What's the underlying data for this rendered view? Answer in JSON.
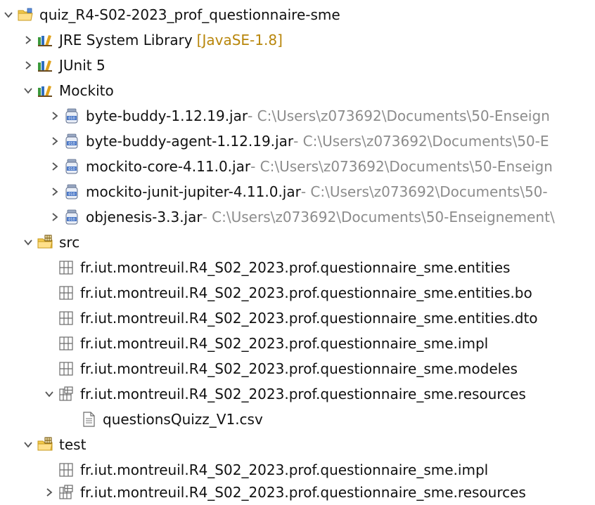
{
  "tree": {
    "project": {
      "label": "quiz_R4-S02-2023_prof_questionnaire-sme",
      "expanded": true,
      "icon": "project-folder-icon",
      "children": {
        "jre": {
          "label": "JRE System Library",
          "decoration": "[JavaSE-1.8]",
          "expanded": false,
          "icon": "library-icon"
        },
        "junit": {
          "label": "JUnit 5",
          "expanded": false,
          "icon": "library-icon"
        },
        "mockito": {
          "label": "Mockito",
          "expanded": true,
          "icon": "library-icon",
          "jars": [
            {
              "label": "byte-buddy-1.12.19.jar",
              "decoration": " - C:\\Users\\z073692\\Documents\\50-Enseign",
              "expanded": false,
              "icon": "jar-icon"
            },
            {
              "label": "byte-buddy-agent-1.12.19.jar",
              "decoration": " - C:\\Users\\z073692\\Documents\\50-E",
              "expanded": false,
              "icon": "jar-icon"
            },
            {
              "label": "mockito-core-4.11.0.jar",
              "decoration": " - C:\\Users\\z073692\\Documents\\50-Enseign",
              "expanded": false,
              "icon": "jar-icon"
            },
            {
              "label": "mockito-junit-jupiter-4.11.0.jar",
              "decoration": " - C:\\Users\\z073692\\Documents\\50-",
              "expanded": false,
              "icon": "jar-icon"
            },
            {
              "label": "objenesis-3.3.jar",
              "decoration": " - C:\\Users\\z073692\\Documents\\50-Enseignement\\",
              "expanded": false,
              "icon": "jar-icon"
            }
          ]
        },
        "src": {
          "label": "src",
          "expanded": true,
          "icon": "source-folder-icon",
          "packages": [
            {
              "label": "fr.iut.montreuil.R4_S02_2023.prof.questionnaire_sme.entities",
              "icon": "package-icon"
            },
            {
              "label": "fr.iut.montreuil.R4_S02_2023.prof.questionnaire_sme.entities.bo",
              "icon": "package-icon"
            },
            {
              "label": "fr.iut.montreuil.R4_S02_2023.prof.questionnaire_sme.entities.dto",
              "icon": "package-icon"
            },
            {
              "label": "fr.iut.montreuil.R4_S02_2023.prof.questionnaire_sme.impl",
              "icon": "package-icon"
            },
            {
              "label": "fr.iut.montreuil.R4_S02_2023.prof.questionnaire_sme.modeles",
              "icon": "package-icon"
            },
            {
              "label": "fr.iut.montreuil.R4_S02_2023.prof.questionnaire_sme.resources",
              "expanded": true,
              "icon": "resource-package-icon"
            }
          ],
          "resource_file": {
            "label": "questionsQuizz_V1.csv",
            "icon": "csv-file-icon"
          }
        },
        "test": {
          "label": "test",
          "expanded": true,
          "icon": "source-folder-icon",
          "packages": [
            {
              "label": "fr.iut.montreuil.R4_S02_2023.prof.questionnaire_sme.impl",
              "icon": "package-icon"
            },
            {
              "label": "fr.iut.montreuil.R4_S02_2023.prof.questionnaire_sme.resources",
              "expanded": false,
              "icon": "resource-package-icon"
            }
          ]
        }
      }
    }
  },
  "colors": {
    "text": "#111111",
    "decoration_gray": "#8c8c8c",
    "decoration_library": "#b8860b",
    "folder_yellow": "#f2c94c",
    "jar_blue": "#4a78c8",
    "twisty": "#555555"
  }
}
